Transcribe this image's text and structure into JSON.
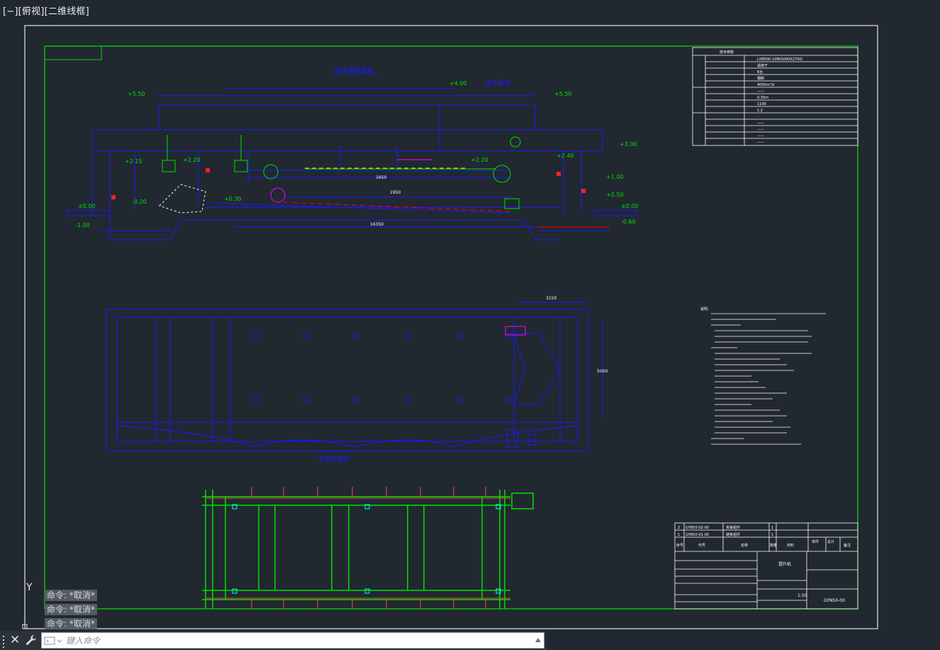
{
  "viewport": {
    "label": "[−][俯视][二维线框]"
  },
  "colors": {
    "background": "#212830",
    "sheet_border": "#e6e6e6",
    "frame": "#00ff00",
    "blue_lines": "#0000ff",
    "green_lines": "#00ff00",
    "magenta": "#ff00ff",
    "red": "#ff0000",
    "yellow": "#ffff00",
    "white_text": "#ffffff"
  },
  "drawing": {
    "section_title_1": "进水渠道盖板",
    "section_title_2": "进水渠道",
    "plan_title": "平面布置图",
    "elevations": [
      "+5.50",
      "+4.00",
      "+5.50",
      "+3.00",
      "+2.20",
      "+2.20",
      "+2.40",
      "+2.15",
      "+1.00",
      "+0.50",
      "±0.00",
      "±0.00",
      "+0.30",
      "-0.20",
      "-1.00",
      "-0.60"
    ],
    "dimensions_top": [
      "1650",
      "1950",
      "16350"
    ],
    "dimension_width": "3150",
    "dimension_height": "5000",
    "notes_heading": "说明："
  },
  "param_table": {
    "title": "技术参数",
    "rows": [
      "LXB500-10M(5000X2700)",
      "适用于",
      "6台",
      "钢制",
      "4000m³/d",
      "——",
      "0.35m",
      "1100",
      "1:2",
      "-",
      "——",
      "——",
      "——",
      "——"
    ]
  },
  "bom": {
    "rows": [
      {
        "no": "2",
        "code": "GYN50-02-00",
        "name": "夹板组件",
        "qty": "1"
      },
      {
        "no": "1",
        "code": "GYN50-01-00",
        "name": "链条组件",
        "qty": "1"
      }
    ],
    "headers": [
      "序号",
      "代号",
      "名称",
      "数量",
      "材料",
      "单件",
      "总计",
      "备注"
    ]
  },
  "title_block": {
    "scale": "1:50",
    "drawing_no": "GYN50-00",
    "name": "提升机"
  },
  "command_history": [
    "命令: *取消*",
    "命令: *取消*",
    "命令: *取消*"
  ],
  "command_line": {
    "placeholder": "键入命令"
  },
  "ucs_icon": {
    "axis_label": "Y"
  }
}
